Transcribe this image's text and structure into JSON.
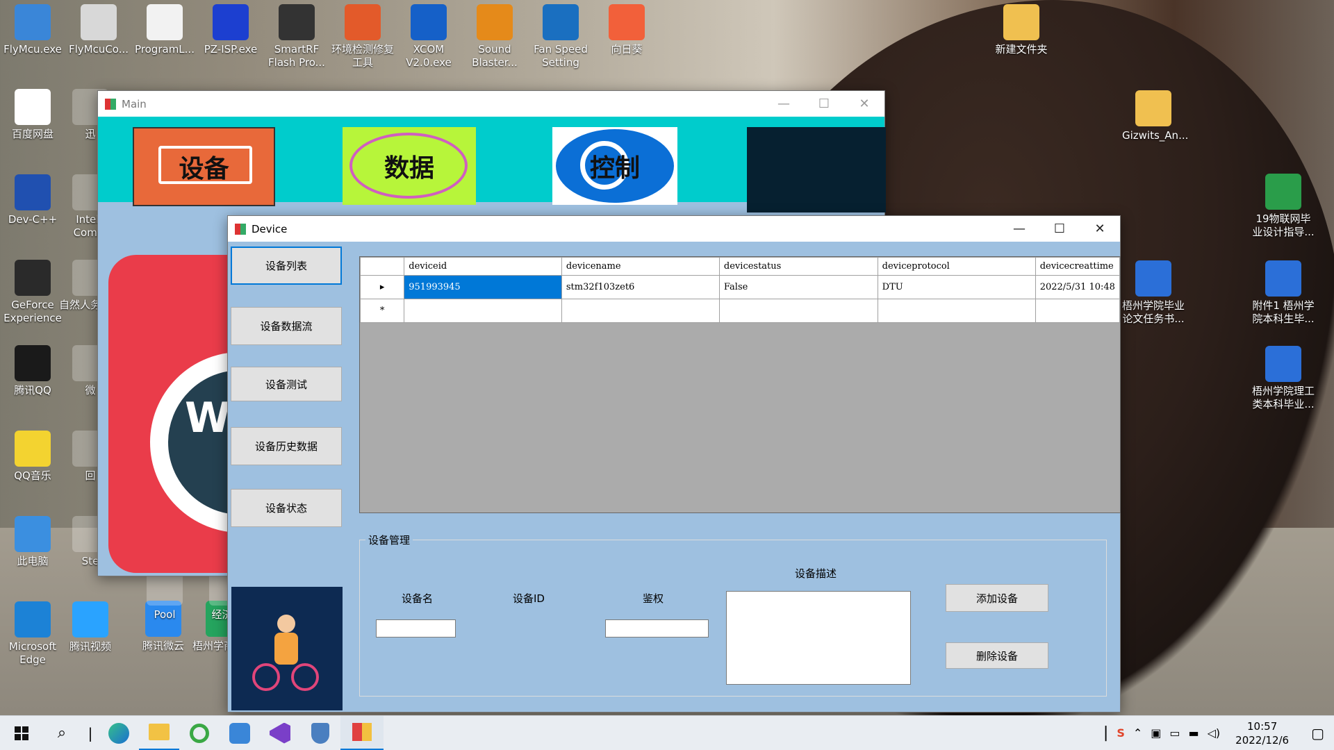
{
  "desktop": {
    "icons_top": [
      {
        "label": "FlyMcu.exe",
        "color": "#3a86d8"
      },
      {
        "label": "FlyMcuCo...",
        "color": "#d8d8d8"
      },
      {
        "label": "ProgramL...",
        "color": "#f2f2f2"
      },
      {
        "label": "PZ-ISP.exe",
        "color": "#1c3fd0"
      },
      {
        "label": "SmartRF Flash Pro...",
        "color": "#333333"
      },
      {
        "label": "环境检测修复工具",
        "color": "#e35a2a"
      },
      {
        "label": "XCOM V2.0.exe",
        "color": "#1560c8"
      },
      {
        "label": "Sound Blaster...",
        "color": "#e58a1a"
      },
      {
        "label": "Fan Speed Setting",
        "color": "#1a6fc0"
      },
      {
        "label": "向日葵",
        "color": "#f2603a"
      }
    ],
    "icons_left": [
      {
        "label": "百度网盘",
        "color": "#ffffff"
      },
      {
        "label": "Dev-C++",
        "color": "#2050b0"
      },
      {
        "label": "GeForce Experience",
        "color": "#2a2a2a"
      },
      {
        "label": "腾讯QQ",
        "color": "#1a1a1a"
      },
      {
        "label": "QQ音乐",
        "color": "#f3d330"
      },
      {
        "label": "此电脑",
        "color": "#3b8fe0"
      },
      {
        "label": "Microsoft Edge",
        "color": "#1c82d6"
      }
    ],
    "icons_left2": [
      {
        "label": "迅"
      },
      {
        "label": "Intelli Comm"
      },
      {
        "label": "自然人务局（"
      },
      {
        "label": "微"
      },
      {
        "label": "回"
      },
      {
        "label": "Ste"
      },
      {
        "label": "腾讯视频",
        "color": "#2aa3ff"
      }
    ],
    "icons_bottom_extra": [
      {
        "label": "腾讯微云",
        "color": "#2a89ee"
      },
      {
        "label": "梧州学商务伴",
        "color": "#25a45e"
      },
      {
        "label": "Pool"
      },
      {
        "label": "经济科"
      }
    ],
    "icons_right": [
      {
        "label": "新建文件夹",
        "color": "#f0c050"
      },
      {
        "label": "Gizwits_An...",
        "color": "#f0c050"
      },
      {
        "label": "19物联网毕业设计指导...",
        "color": "#2a9d4a"
      },
      {
        "label": "梧州学院毕业论文任务书...",
        "color": "#2b6fd8"
      },
      {
        "label": "附件1 梧州学院本科生毕...",
        "color": "#2b6fd8"
      },
      {
        "label": "梧州学院理工类本科毕业...",
        "color": "#2b6fd8"
      }
    ]
  },
  "main_window": {
    "title": "Main",
    "controls": {
      "min": "—",
      "max": "☐",
      "close": "✕"
    },
    "banner": {
      "device": "设备",
      "data": "数据",
      "control": "控制"
    },
    "logo_text": "W"
  },
  "device_window": {
    "title": "Device",
    "controls": {
      "min": "—",
      "max": "☐",
      "close": "✕"
    },
    "nav": [
      "设备列表",
      "设备数据流",
      "设备测试",
      "设备历史数据",
      "设备状态"
    ],
    "grid": {
      "columns": [
        "deviceid",
        "devicename",
        "devicestatus",
        "deviceprotocol",
        "devicecreattime"
      ],
      "rows": [
        [
          "951993945",
          "stm32f103zet6",
          "False",
          "DTU",
          "2022/5/31 10:48"
        ]
      ],
      "row_marker": "▸",
      "new_row_marker": "*"
    },
    "group": {
      "title": "设备管理",
      "desc_label": "设备描述",
      "name_label": "设备名",
      "id_label": "设备ID",
      "auth_label": "鉴权",
      "name_value": "",
      "auth_value": "",
      "desc_value": "",
      "add_button": "添加设备",
      "delete_button": "删除设备"
    }
  },
  "taskbar": {
    "time": "10:57",
    "date": "2022/12/6"
  },
  "colors": {
    "banner": "#00cccc",
    "device_btn": "#e8693a",
    "data_btn": "#b7f53a",
    "control_btn": "#0b6fd6",
    "window_body": "#9ec0e0",
    "selected": "#0078d7"
  }
}
